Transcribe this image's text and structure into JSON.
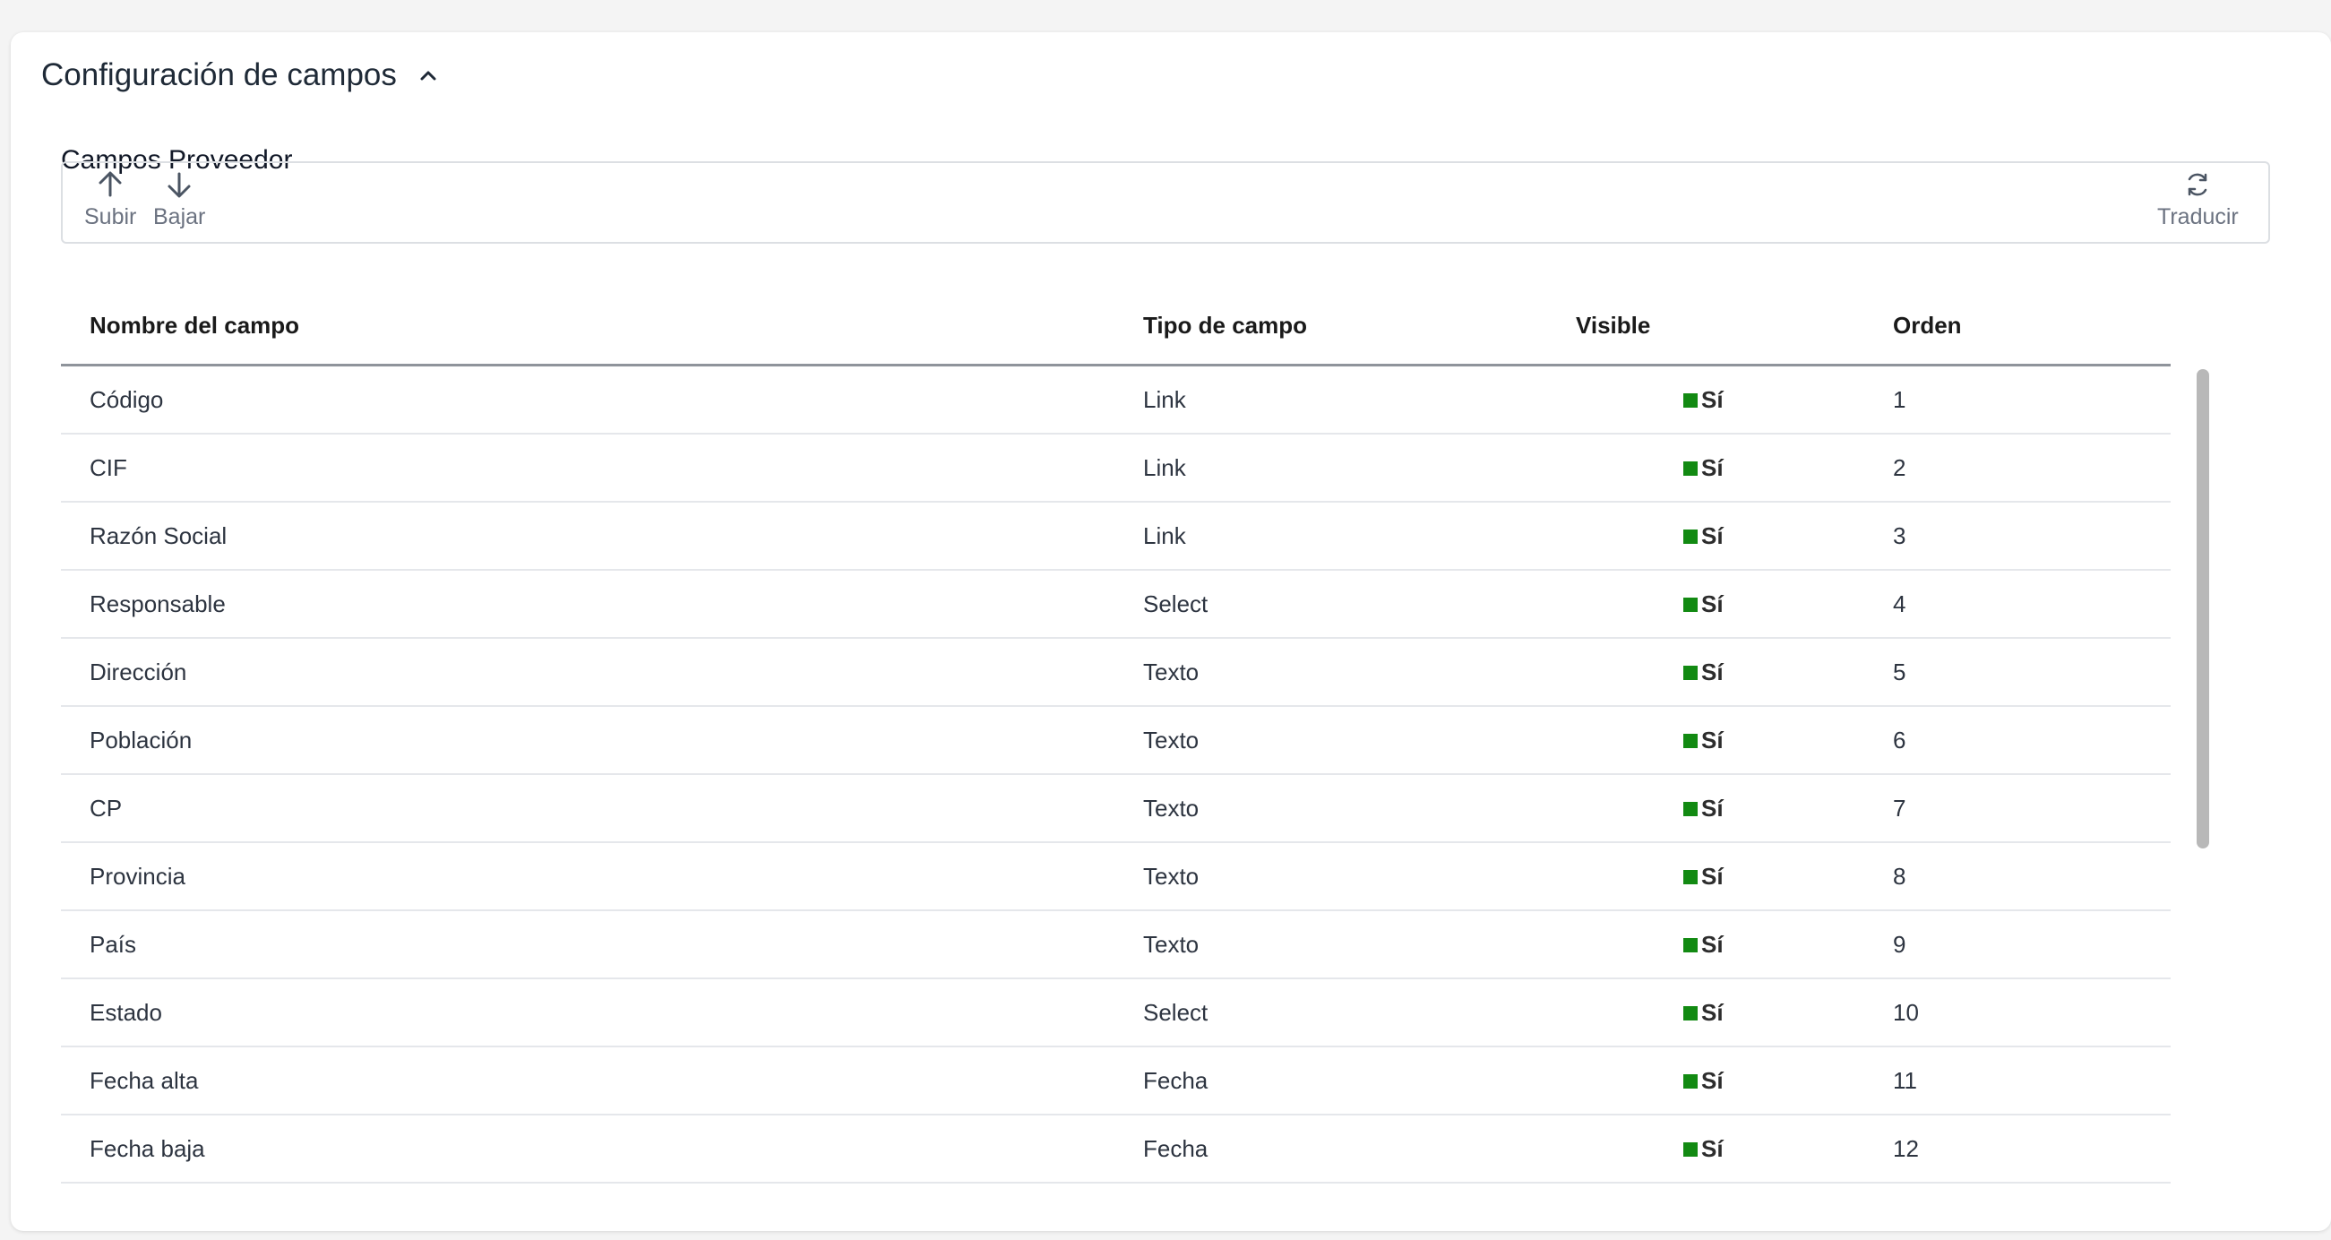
{
  "section": {
    "title": "Configuración de campos",
    "chevron_icon": "chevron-up-icon"
  },
  "subtitle": "Campos Proveedor",
  "toolbar": {
    "up_label": "Subir",
    "up_icon": "arrow-up-icon",
    "down_label": "Bajar",
    "down_icon": "arrow-down-icon",
    "translate_label": "Traducir",
    "translate_icon": "refresh-icon"
  },
  "table": {
    "headers": {
      "name": "Nombre del campo",
      "type": "Tipo de campo",
      "visible": "Visible",
      "order": "Orden"
    },
    "visible_color": "#128a12",
    "rows": [
      {
        "name": "Código",
        "type": "Link",
        "visible": "Sí",
        "order": "1"
      },
      {
        "name": "CIF",
        "type": "Link",
        "visible": "Sí",
        "order": "2"
      },
      {
        "name": "Razón Social",
        "type": "Link",
        "visible": "Sí",
        "order": "3"
      },
      {
        "name": "Responsable",
        "type": "Select",
        "visible": "Sí",
        "order": "4"
      },
      {
        "name": "Dirección",
        "type": "Texto",
        "visible": "Sí",
        "order": "5"
      },
      {
        "name": "Población",
        "type": "Texto",
        "visible": "Sí",
        "order": "6"
      },
      {
        "name": "CP",
        "type": "Texto",
        "visible": "Sí",
        "order": "7"
      },
      {
        "name": "Provincia",
        "type": "Texto",
        "visible": "Sí",
        "order": "8"
      },
      {
        "name": "País",
        "type": "Texto",
        "visible": "Sí",
        "order": "9"
      },
      {
        "name": "Estado",
        "type": "Select",
        "visible": "Sí",
        "order": "10"
      },
      {
        "name": "Fecha alta",
        "type": "Fecha",
        "visible": "Sí",
        "order": "11"
      },
      {
        "name": "Fecha baja",
        "type": "Fecha",
        "visible": "Sí",
        "order": "12"
      }
    ]
  }
}
